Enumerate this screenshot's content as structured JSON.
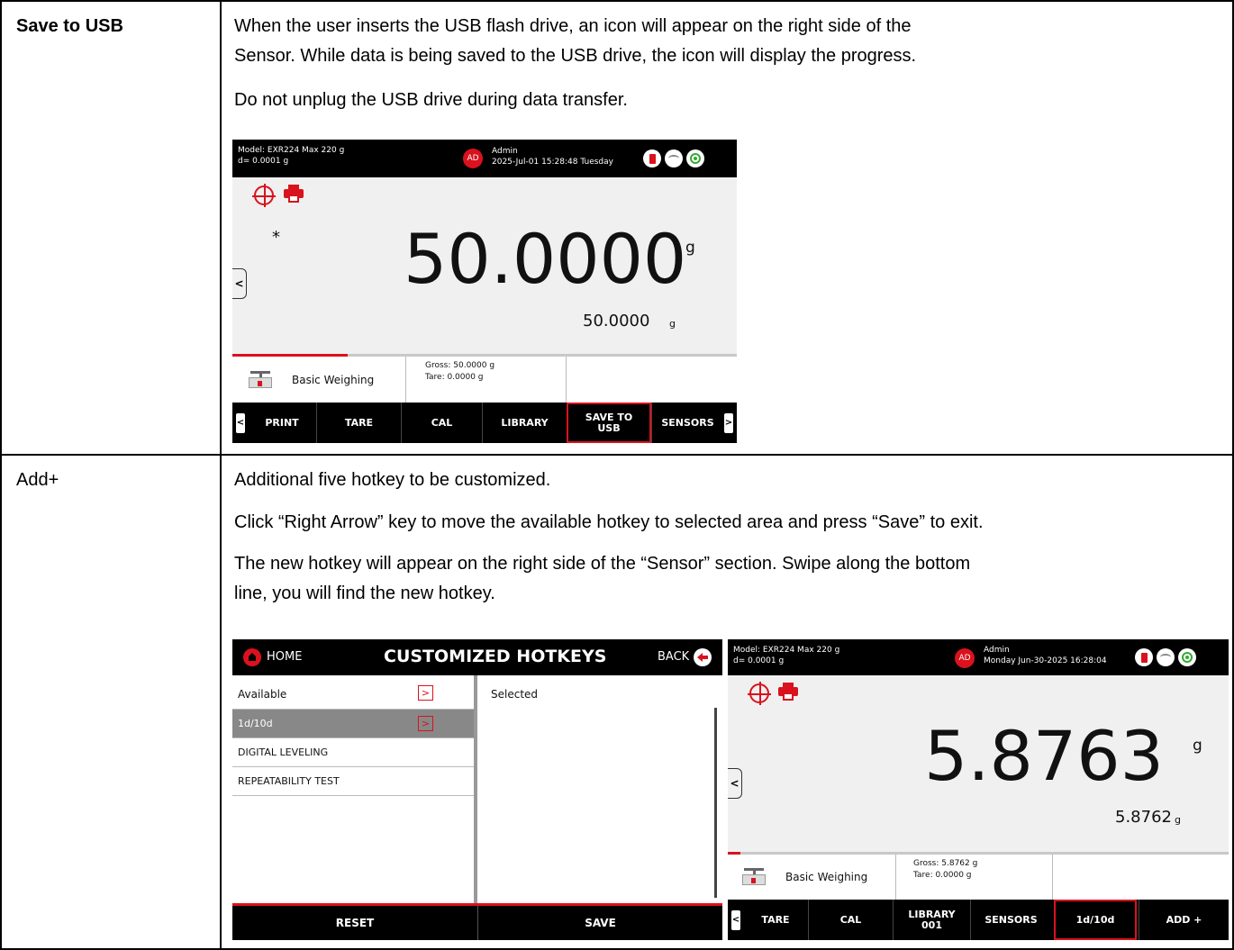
{
  "rows": [
    {
      "title": "Save to USB",
      "paragraphs": [
        "When the user inserts the USB flash drive, an icon will appear on the right side of the",
        "Sensor.  While data is being saved to the USB drive, the icon will display the progress.",
        "Do not unplug the USB drive during data transfer."
      ]
    },
    {
      "title": "Add+",
      "paragraphs": [
        "Additional five hotkey to be customized.",
        "Click “Right Arrow” key to move the available hotkey to selected area and press “Save” to exit.",
        "The new hotkey will appear on the right side of the “Sensor” section. Swipe along the bottom",
        "line, you will find the new hotkey."
      ]
    }
  ],
  "screen1": {
    "model": "Model: EXR224   Max 220 g",
    "resolution": "d= 0.0001 g",
    "avatar": "AD",
    "user": "Admin",
    "datetime": "2025-Jul-01 15:28:48 Tuesday",
    "asterisk": "*",
    "weight": "50.0000",
    "unit": "g",
    "sub_weight": "50.0000",
    "sub_unit": "g",
    "app_name": "Basic Weighing",
    "gross": "Gross: 50.0000 g",
    "tare": "Tare: 0.0000 g",
    "hotkeys": [
      "PRINT",
      "TARE",
      "CAL",
      "LIBRARY",
      "SAVE TO\nUSB",
      "SENSORS"
    ],
    "highlighted_hotkey": "SAVE TO USB",
    "left_arrow": "<",
    "right_arrow": ">",
    "side_arrow": "<"
  },
  "screen2": {
    "home": "HOME",
    "title": "CUSTOMIZED HOTKEYS",
    "back": "BACK",
    "available": "Available",
    "selected": "Selected",
    "items": [
      "1d/10d",
      "DIGITAL LEVELING",
      "REPEATABILITY TEST"
    ],
    "arrow": ">",
    "reset": "RESET",
    "save": "SAVE"
  },
  "screen3": {
    "model": "Model: EXR224   Max 220 g",
    "resolution": "d= 0.0001 g",
    "avatar": "AD",
    "user": "Admin",
    "datetime": "Monday Jun-30-2025 16:28:04",
    "weight": "5.8763",
    "unit": "g",
    "sub_weight": "5.8762",
    "sub_unit": "g",
    "app_name": "Basic Weighing",
    "gross": "Gross: 5.8762 g",
    "tare": "Tare: 0.0000 g",
    "hotkeys": [
      "TARE",
      "CAL",
      "LIBRARY\n001",
      "SENSORS",
      "1d/10d",
      "ADD +"
    ],
    "highlighted_hotkey": "1d/10d",
    "left_arrow": "<",
    "side_arrow": "<"
  },
  "colors": {
    "accent": "#d9121d",
    "bar": "#000000",
    "screen_bg": "#f0f0f0"
  }
}
